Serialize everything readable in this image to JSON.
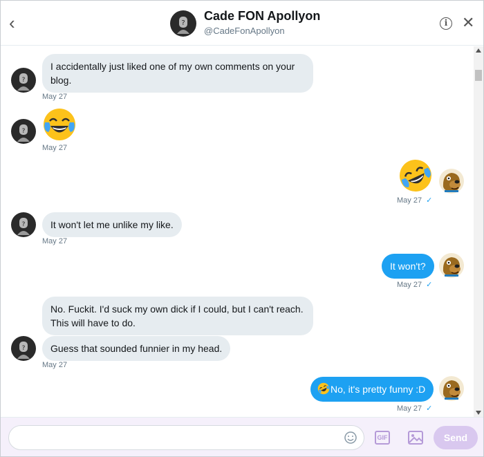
{
  "header": {
    "name": "Cade FON Apollyon",
    "handle": "@CadeFonApollyon"
  },
  "messages": [
    {
      "text": "I accidentally just liked one of my own comments on your",
      "text2": "blog.",
      "time": "May 27"
    },
    {
      "emoji": "joy-emoji",
      "time": "May 27"
    },
    {
      "emoji": "rofl-emoji",
      "time": "May 27"
    },
    {
      "text": "It won't let me unlike my like.",
      "time": "May 27"
    },
    {
      "text": "It won't?",
      "time": "May 27"
    },
    {
      "text": "No. Fuckit. I'd suck my own dick if I could, but I can't reach.",
      "text2": "This will have to do."
    },
    {
      "text": "Guess that sounded funnier in my head.",
      "time": "May 27"
    },
    {
      "text": "No, it's pretty funny :D",
      "time": "May 27"
    }
  ],
  "composer": {
    "gif_label": "GIF",
    "send_label": "Send"
  },
  "colors": {
    "accent": "#1da1f2",
    "incoming_bubble": "#e6ecf0",
    "send_disabled": "#d9c8ef"
  }
}
